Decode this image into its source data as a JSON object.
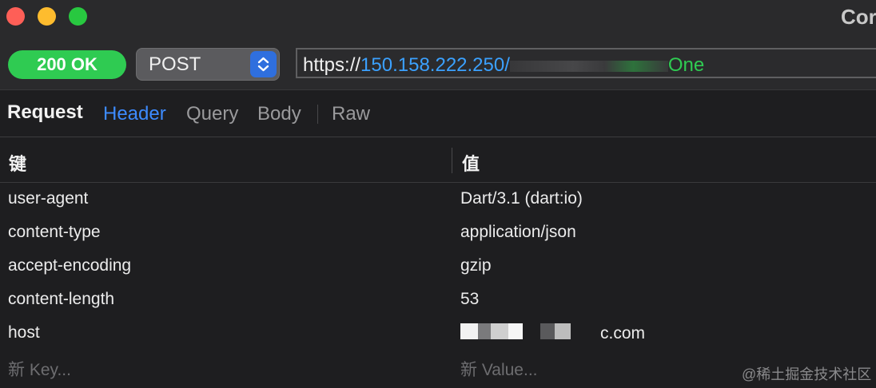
{
  "window": {
    "title": "Cor"
  },
  "toolbar": {
    "status": "200 OK",
    "status_color": "#2fcb52",
    "method": "POST",
    "url": {
      "scheme": "https://",
      "host": "150.158.222.250/",
      "path_end": "One"
    }
  },
  "tabs": {
    "section_label": "Request",
    "items": [
      "Header",
      "Query",
      "Body",
      "Raw"
    ],
    "active": "Header"
  },
  "table": {
    "columns": [
      "键",
      "值"
    ],
    "rows": [
      {
        "key": "user-agent",
        "value": "Dart/3.1 (dart:io)"
      },
      {
        "key": "content-type",
        "value": "application/json"
      },
      {
        "key": "accept-encoding",
        "value": "gzip"
      },
      {
        "key": "content-length",
        "value": "53"
      },
      {
        "key": "host",
        "value": "c.com"
      }
    ],
    "new_key_placeholder": "新 Key...",
    "new_value_placeholder": "新 Value..."
  },
  "watermark": "@稀土掘金技术社区",
  "icons": {
    "method_stepper": "chevron-up-down-icon"
  }
}
